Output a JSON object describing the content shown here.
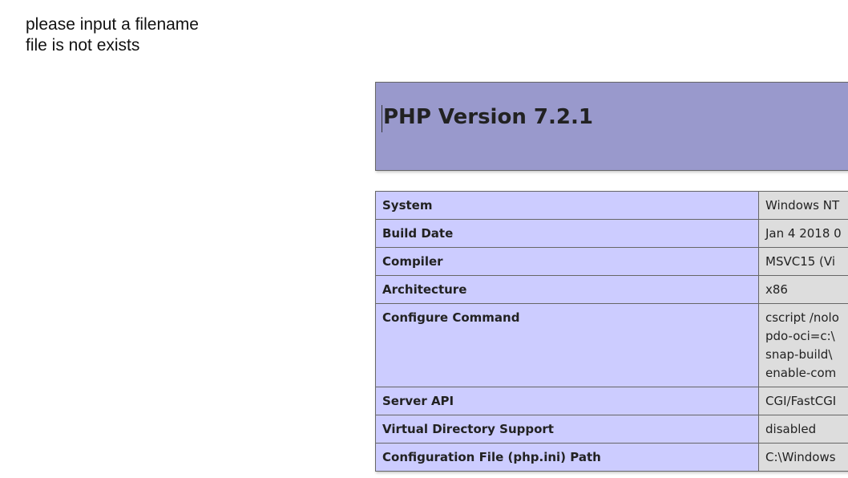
{
  "messages": {
    "line1": "please input a filename",
    "line2": "file is not exists"
  },
  "phpinfo": {
    "title": "PHP Version 7.2.1",
    "colors": {
      "header_bg": "#9999cc",
      "key_bg": "#ccccff",
      "value_bg": "#dddddd"
    },
    "rows": [
      {
        "key": "System",
        "value": "Windows NT"
      },
      {
        "key": "Build Date",
        "value": "Jan 4 2018 0"
      },
      {
        "key": "Compiler",
        "value": "MSVC15 (Vi"
      },
      {
        "key": "Architecture",
        "value": "x86"
      },
      {
        "key": "Configure Command",
        "value_lines": [
          "cscript /nolo",
          "pdo-oci=c:\\",
          "snap-build\\",
          "enable-com"
        ]
      },
      {
        "key": "Server API",
        "value": "CGI/FastCGI"
      },
      {
        "key": "Virtual Directory Support",
        "value": "disabled"
      },
      {
        "key": "Configuration File (php.ini) Path",
        "value": "C:\\Windows"
      }
    ]
  }
}
